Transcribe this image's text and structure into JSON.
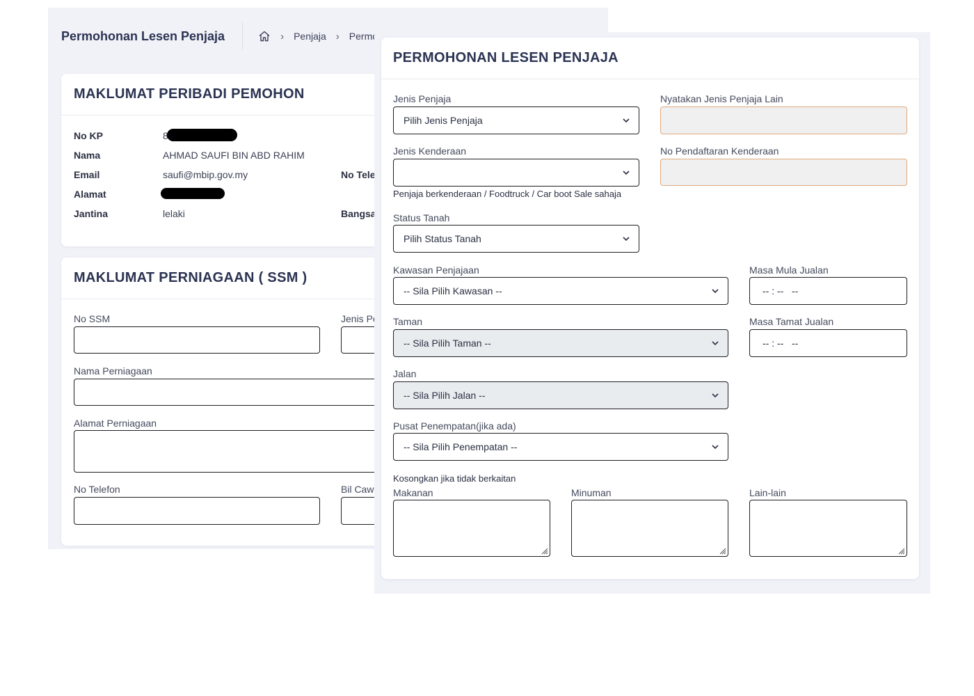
{
  "page": {
    "title": "Permohonan Lesen Penjaja",
    "breadcrumb": {
      "item1": "Penjaja",
      "item2": "Permo"
    }
  },
  "personal": {
    "header": "MAKLUMAT PERIBADI PEMOHON",
    "no_kp_label": "No KP",
    "no_kp_value": "8",
    "nama_label": "Nama",
    "nama_value": "AHMAD SAUFI BIN ABD RAHIM",
    "email_label": "Email",
    "email_value": "saufi@mbip.gov.my",
    "no_tel_label": "No Tele",
    "alamat_label": "Alamat",
    "jantina_label": "Jantina",
    "jantina_value": "lelaki",
    "bangsa_label": "Bangsa"
  },
  "business": {
    "header": "MAKLUMAT PERNIAGAAN ( SSM )",
    "no_ssm_label": "No SSM",
    "jenis_label": "Jenis Pe",
    "nama_label": "Nama Perniagaan",
    "alamat_label": "Alamat Perniagaan",
    "no_telefon_label": "No Telefon",
    "bil_label": "Bil Caw"
  },
  "modal": {
    "title": "PERMOHONAN LESEN PENJAJA",
    "jenis_penjaja": {
      "label": "Jenis Penjaja",
      "value": "Pilih Jenis Penjaja"
    },
    "jenis_lain": {
      "label": "Nyatakan Jenis Penjaja Lain"
    },
    "jenis_kenderaan": {
      "label": "Jenis Kenderaan",
      "value": ""
    },
    "no_pendaftaran": {
      "label": "No Pendaftaran Kenderaan"
    },
    "kenderaan_note": "Penjaja berkenderaan / Foodtruck / Car boot Sale sahaja",
    "status_tanah": {
      "label": "Status Tanah",
      "value": "Pilih Status Tanah"
    },
    "kawasan": {
      "label": "Kawasan Penjajaan",
      "value": "-- Sila Pilih Kawasan --"
    },
    "masa_mula": {
      "label": "Masa Mula Jualan",
      "value": "-- : --   --"
    },
    "taman": {
      "label": "Taman",
      "value": "-- Sila Pilih Taman --"
    },
    "masa_tamat": {
      "label": "Masa Tamat Jualan",
      "value": "-- : --   --"
    },
    "jalan": {
      "label": "Jalan",
      "value": "-- Sila Pilih Jalan --"
    },
    "pusat": {
      "label": "Pusat Penempatan(jika ada)",
      "value": "-- Sila Pilih Penempatan --"
    },
    "kosong_note": "Kosongkan jika tidak berkaitan",
    "makanan": {
      "label": "Makanan"
    },
    "minuman": {
      "label": "Minuman"
    },
    "lain": {
      "label": "Lain-lain"
    }
  },
  "icons": {
    "home": "home-icon",
    "chevron_right": "chevron-right-icon",
    "chevron_down": "chevron-down-icon",
    "resize": "resize-grip-icon"
  }
}
